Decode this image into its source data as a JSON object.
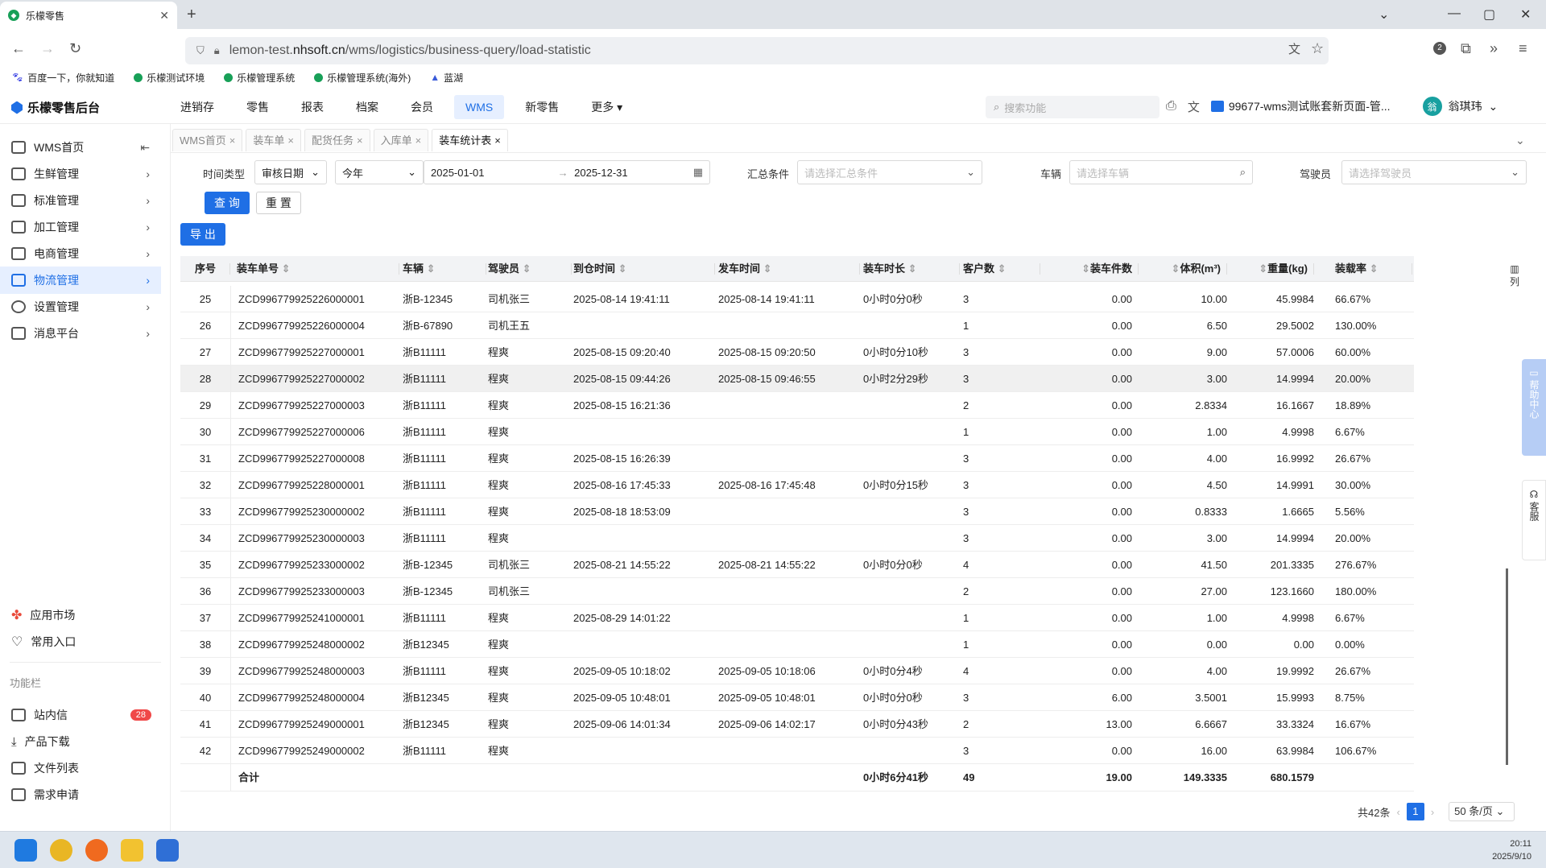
{
  "browser": {
    "tab_title": "乐檬零售",
    "url_prefix": "lemon-test.",
    "url_domain": "nhsoft.cn",
    "url_path": "/wms/logistics/business-query/load-statistic",
    "bookmarks": [
      "百度一下，你就知道",
      "乐檬测试环境",
      "乐檬管理系统",
      "乐檬管理系统(海外)",
      "蓝湖"
    ],
    "ext_badge": "2"
  },
  "header": {
    "logo": "乐檬零售后台",
    "nav": [
      "进销存",
      "零售",
      "报表",
      "档案",
      "会员",
      "WMS",
      "新零售",
      "更多"
    ],
    "active_nav": "WMS",
    "search_placeholder": "搜索功能",
    "account": "99677-wms测试账套新页面-管...",
    "user": "翁琪玮",
    "user_initial": "翁"
  },
  "sidebar": {
    "items": [
      {
        "label": "WMS首页",
        "icon": "home-icon"
      },
      {
        "label": "生鲜管理",
        "icon": "fresh-icon"
      },
      {
        "label": "标准管理",
        "icon": "standard-icon"
      },
      {
        "label": "加工管理",
        "icon": "process-icon"
      },
      {
        "label": "电商管理",
        "icon": "ecommerce-icon"
      },
      {
        "label": "物流管理",
        "icon": "logistics-icon"
      },
      {
        "label": "设置管理",
        "icon": "settings-icon"
      },
      {
        "label": "消息平台",
        "icon": "message-icon"
      }
    ],
    "bottom": [
      "应用市场",
      "常用入口"
    ],
    "section": "功能栏",
    "tools": [
      "站内信",
      "产品下载",
      "文件列表",
      "需求申请"
    ],
    "inbox_count": "28"
  },
  "page_tabs": [
    "WMS首页",
    "装车单",
    "配货任务",
    "入库单",
    "装车统计表"
  ],
  "filters": {
    "time_type_label": "时间类型",
    "time_type_value": "审核日期",
    "period_value": "今年",
    "date_start": "2025-01-01",
    "date_end": "2025-12-31",
    "summary_label": "汇总条件",
    "summary_placeholder": "请选择汇总条件",
    "vehicle_label": "车辆",
    "vehicle_placeholder": "请选择车辆",
    "driver_label": "驾驶员",
    "driver_placeholder": "请选择驾驶员",
    "query": "查 询",
    "reset": "重 置",
    "export": "导 出"
  },
  "table": {
    "columns": [
      "序号",
      "装车单号",
      "车辆",
      "驾驶员",
      "到仓时间",
      "发车时间",
      "装车时长",
      "客户数",
      "装车件数",
      "体积(m³)",
      "重量(kg)",
      "装载率"
    ],
    "rows": [
      [
        "25",
        "ZCD996779925226000001",
        "浙B-12345",
        "司机张三",
        "2025-08-14 19:41:11",
        "2025-08-14 19:41:11",
        "0小时0分0秒",
        "3",
        "0.00",
        "10.00",
        "45.9984",
        "66.67%"
      ],
      [
        "26",
        "ZCD996779925226000004",
        "浙B-67890",
        "司机王五",
        "",
        "",
        "",
        "1",
        "0.00",
        "6.50",
        "29.5002",
        "130.00%"
      ],
      [
        "27",
        "ZCD996779925227000001",
        "浙B11111",
        "程爽",
        "2025-08-15 09:20:40",
        "2025-08-15 09:20:50",
        "0小时0分10秒",
        "3",
        "0.00",
        "9.00",
        "57.0006",
        "60.00%"
      ],
      [
        "28",
        "ZCD996779925227000002",
        "浙B11111",
        "程爽",
        "2025-08-15 09:44:26",
        "2025-08-15 09:46:55",
        "0小时2分29秒",
        "3",
        "0.00",
        "3.00",
        "14.9994",
        "20.00%"
      ],
      [
        "29",
        "ZCD996779925227000003",
        "浙B11111",
        "程爽",
        "2025-08-15 16:21:36",
        "",
        "",
        "2",
        "0.00",
        "2.8334",
        "16.1667",
        "18.89%"
      ],
      [
        "30",
        "ZCD996779925227000006",
        "浙B11111",
        "程爽",
        "",
        "",
        "",
        "1",
        "0.00",
        "1.00",
        "4.9998",
        "6.67%"
      ],
      [
        "31",
        "ZCD996779925227000008",
        "浙B11111",
        "程爽",
        "2025-08-15 16:26:39",
        "",
        "",
        "3",
        "0.00",
        "4.00",
        "16.9992",
        "26.67%"
      ],
      [
        "32",
        "ZCD996779925228000001",
        "浙B11111",
        "程爽",
        "2025-08-16 17:45:33",
        "2025-08-16 17:45:48",
        "0小时0分15秒",
        "3",
        "0.00",
        "4.50",
        "14.9991",
        "30.00%"
      ],
      [
        "33",
        "ZCD996779925230000002",
        "浙B11111",
        "程爽",
        "2025-08-18 18:53:09",
        "",
        "",
        "3",
        "0.00",
        "0.8333",
        "1.6665",
        "5.56%"
      ],
      [
        "34",
        "ZCD996779925230000003",
        "浙B11111",
        "程爽",
        "",
        "",
        "",
        "3",
        "0.00",
        "3.00",
        "14.9994",
        "20.00%"
      ],
      [
        "35",
        "ZCD996779925233000002",
        "浙B-12345",
        "司机张三",
        "2025-08-21 14:55:22",
        "2025-08-21 14:55:22",
        "0小时0分0秒",
        "4",
        "0.00",
        "41.50",
        "201.3335",
        "276.67%"
      ],
      [
        "36",
        "ZCD996779925233000003",
        "浙B-12345",
        "司机张三",
        "",
        "",
        "",
        "2",
        "0.00",
        "27.00",
        "123.1660",
        "180.00%"
      ],
      [
        "37",
        "ZCD996779925241000001",
        "浙B11111",
        "程爽",
        "2025-08-29 14:01:22",
        "",
        "",
        "1",
        "0.00",
        "1.00",
        "4.9998",
        "6.67%"
      ],
      [
        "38",
        "ZCD996779925248000002",
        "浙B12345",
        "程爽",
        "",
        "",
        "",
        "1",
        "0.00",
        "0.00",
        "0.00",
        "0.00%"
      ],
      [
        "39",
        "ZCD996779925248000003",
        "浙B11111",
        "程爽",
        "2025-09-05 10:18:02",
        "2025-09-05 10:18:06",
        "0小时0分4秒",
        "4",
        "0.00",
        "4.00",
        "19.9992",
        "26.67%"
      ],
      [
        "40",
        "ZCD996779925248000004",
        "浙B12345",
        "程爽",
        "2025-09-05 10:48:01",
        "2025-09-05 10:48:01",
        "0小时0分0秒",
        "3",
        "6.00",
        "3.5001",
        "15.9993",
        "8.75%"
      ],
      [
        "41",
        "ZCD996779925249000001",
        "浙B12345",
        "程爽",
        "2025-09-06 14:01:34",
        "2025-09-06 14:02:17",
        "0小时0分43秒",
        "2",
        "13.00",
        "6.6667",
        "33.3324",
        "16.67%"
      ],
      [
        "42",
        "ZCD996779925249000002",
        "浙B11111",
        "程爽",
        "",
        "",
        "",
        "3",
        "0.00",
        "16.00",
        "63.9984",
        "106.67%"
      ]
    ],
    "highlight_row": 3,
    "footer": {
      "label": "合计",
      "duration": "0小时6分41秒",
      "customers": "49",
      "pieces": "19.00",
      "volume": "149.3335",
      "weight": "680.1579"
    }
  },
  "right_float": {
    "columns": "列",
    "help": "帮助中心",
    "service": "客服"
  },
  "pagination": {
    "total": "共42条",
    "page": "1",
    "size": "50 条/页"
  },
  "taskbar": {
    "time": "20:11",
    "date": "2025/9/10"
  }
}
